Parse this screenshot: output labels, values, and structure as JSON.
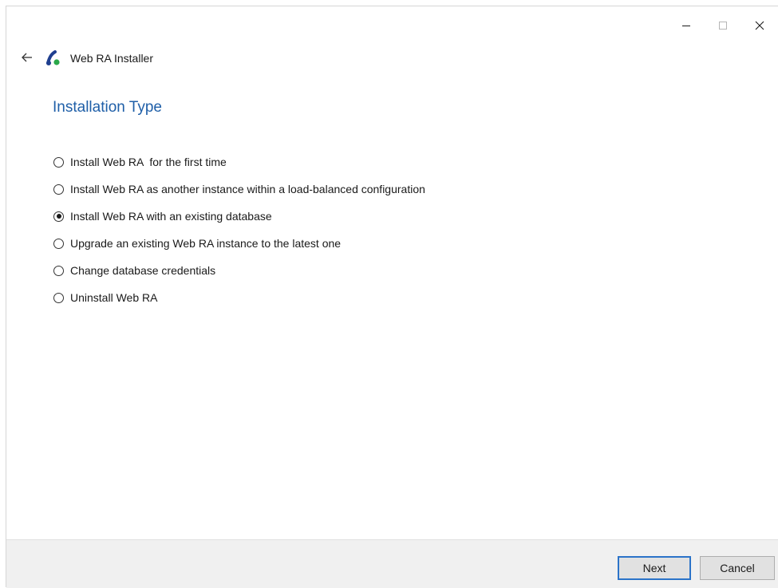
{
  "window": {
    "app_title": "Web RA Installer",
    "caption": {
      "minimize_icon": "minimize-icon",
      "maximize_icon": "maximize-icon",
      "close_icon": "close-icon"
    },
    "back_icon": "back-arrow-icon",
    "logo_icon": "app-logo-icon"
  },
  "page": {
    "title": "Installation Type"
  },
  "options": [
    {
      "label": "Install Web RA  for the first time",
      "checked": false
    },
    {
      "label": "Install Web RA as another instance within a load-balanced configuration",
      "checked": false
    },
    {
      "label": "Install Web RA with an existing database",
      "checked": true
    },
    {
      "label": "Upgrade an existing Web RA instance to the latest one",
      "checked": false
    },
    {
      "label": "Change database credentials",
      "checked": false
    },
    {
      "label": "Uninstall Web RA",
      "checked": false
    }
  ],
  "footer": {
    "next_label": "Next",
    "cancel_label": "Cancel"
  },
  "colors": {
    "accent": "#1f5fa8",
    "primary_button_border": "#2b73c9",
    "footer_bg": "#f0f0f0"
  }
}
